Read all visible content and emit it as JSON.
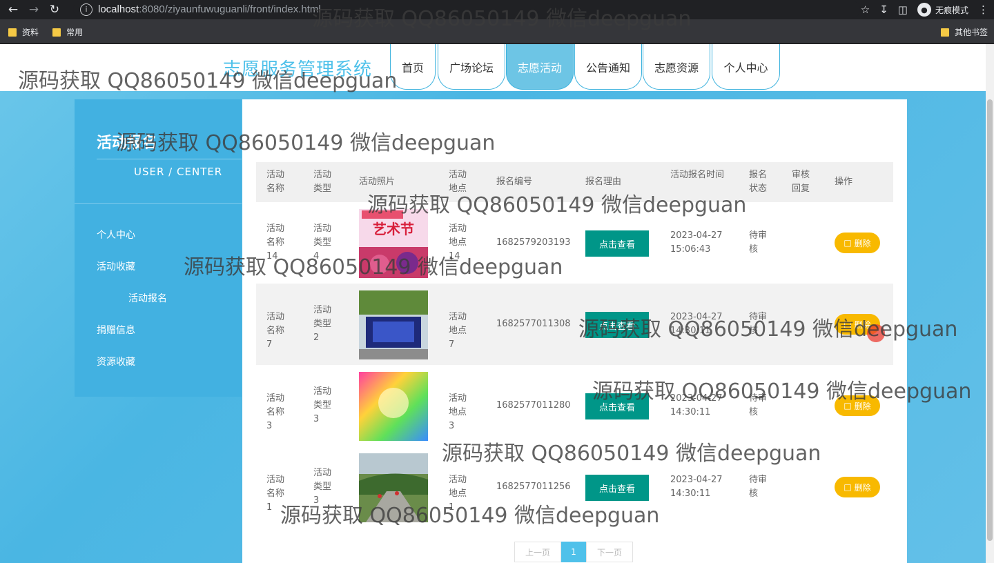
{
  "browser": {
    "url_host": "localhost",
    "url_path": ":8080/ziyaunfuwuguanli/front/index.html",
    "incognito_label": "无痕模式",
    "bookmarks": [
      "资料",
      "常用"
    ],
    "other_bookmarks": "其他书签"
  },
  "site": {
    "title": "志愿服务管理系统",
    "nav": [
      {
        "label": "首页",
        "active": false
      },
      {
        "label": "广场论坛",
        "active": false
      },
      {
        "label": "志愿活动",
        "active": true
      },
      {
        "label": "公告通知",
        "active": false
      },
      {
        "label": "志愿资源",
        "active": false
      },
      {
        "label": "个人中心",
        "active": false
      }
    ]
  },
  "sidebar": {
    "title": "活动报名",
    "subtitle": "USER / CENTER",
    "items": [
      "个人中心",
      "活动收藏",
      "活动报名",
      "捐赠信息",
      "资源收藏"
    ]
  },
  "table": {
    "headers": [
      "活动名称",
      "活动类型",
      "活动照片",
      "活动地点",
      "报名编号",
      "报名理由",
      "活动报名时间",
      "报名状态",
      "审核回复",
      "操作"
    ],
    "rows": [
      {
        "name": "活动名称14",
        "type": "活动类型4",
        "place": "活动地点14",
        "code": "1682579203193",
        "reason_btn": "点击查看",
        "time": "2023-04-27 15:06:43",
        "status": "待审核",
        "reply": "",
        "action": "删除",
        "photo": "art-festival"
      },
      {
        "name": "活动名称7",
        "type": "活动类型2",
        "place": "活动地点7",
        "code": "1682577011308",
        "reason_btn": "点击查看",
        "time": "2023-04-27 14:30:11",
        "status": "待审核",
        "reply": "",
        "action": "删除",
        "photo": "stage"
      },
      {
        "name": "活动名称3",
        "type": "活动类型3",
        "place": "活动地点3",
        "code": "1682577011280",
        "reason_btn": "点击查看",
        "time": "2023-04-27 14:30:11",
        "status": "待审核",
        "reply": "",
        "action": "删除",
        "photo": "rainbow"
      },
      {
        "name": "活动名称1",
        "type": "活动类型3",
        "place": "活动地点1",
        "code": "1682577011256",
        "reason_btn": "点击查看",
        "time": "2023-04-27 14:30:11",
        "status": "待审核",
        "reply": "",
        "action": "删除",
        "photo": "outdoor-walk"
      }
    ]
  },
  "pagination": {
    "prev": "上一页",
    "current": "1",
    "next": "下一页"
  },
  "watermark": "源码获取 QQ86050149 微信deepguan"
}
